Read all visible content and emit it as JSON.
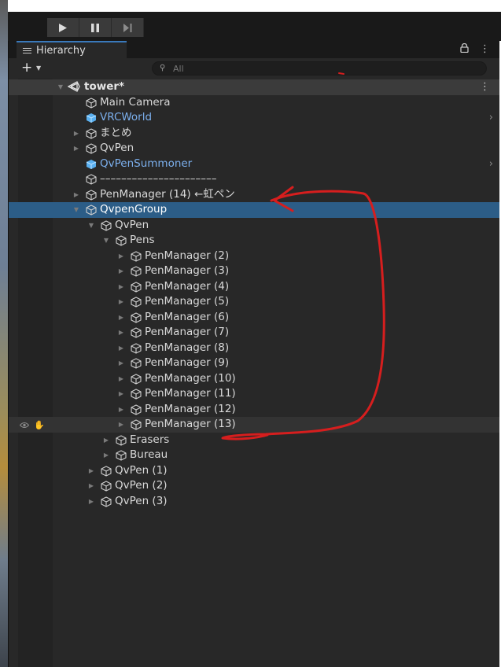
{
  "toolbar": {
    "play_icon": "play-icon",
    "pause_icon": "pause-icon",
    "step_icon": "step-icon"
  },
  "hierarchy_tab": {
    "label": "Hierarchy"
  },
  "search": {
    "add_label": "+",
    "placeholder": "All"
  },
  "scene": {
    "name": "tower*"
  },
  "tree_items": [
    {
      "label": "Main Camera",
      "indent": 1
    },
    {
      "label": "VRCWorld",
      "indent": 1,
      "prefab": true,
      "chevron": true
    },
    {
      "label": "まとめ",
      "indent": 1,
      "arrow": true
    },
    {
      "label": "QvPen",
      "indent": 1,
      "arrow": true
    },
    {
      "label": "QvPenSummoner",
      "indent": 1,
      "prefab": true,
      "chevron": true
    },
    {
      "label": "––––––––––––––––––––––",
      "indent": 1
    },
    {
      "label": "PenManager (14) ←虹ペン",
      "indent": 1,
      "arrow": true
    },
    {
      "label": "QvpenGroup",
      "indent": 1,
      "arrow": true,
      "expanded": true,
      "selected": true
    },
    {
      "label": "QvPen",
      "indent": 2,
      "arrow": true,
      "expanded": true
    },
    {
      "label": "Pens",
      "indent": 3,
      "arrow": true,
      "expanded": true
    },
    {
      "label": "PenManager (2)",
      "indent": 4,
      "arrow": true
    },
    {
      "label": "PenManager (3)",
      "indent": 4,
      "arrow": true
    },
    {
      "label": "PenManager (4)",
      "indent": 4,
      "arrow": true
    },
    {
      "label": "PenManager (5)",
      "indent": 4,
      "arrow": true
    },
    {
      "label": "PenManager (6)",
      "indent": 4,
      "arrow": true
    },
    {
      "label": "PenManager (7)",
      "indent": 4,
      "arrow": true
    },
    {
      "label": "PenManager (8)",
      "indent": 4,
      "arrow": true
    },
    {
      "label": "PenManager (9)",
      "indent": 4,
      "arrow": true
    },
    {
      "label": "PenManager (10)",
      "indent": 4,
      "arrow": true
    },
    {
      "label": "PenManager (11)",
      "indent": 4,
      "arrow": true
    },
    {
      "label": "PenManager (12)",
      "indent": 4,
      "arrow": true
    },
    {
      "label": "PenManager (13)",
      "indent": 4,
      "arrow": true,
      "hovered": true
    },
    {
      "label": "Erasers",
      "indent": 3,
      "arrow": true
    },
    {
      "label": "Bureau",
      "indent": 3,
      "arrow": true
    },
    {
      "label": "QvPen (1)",
      "indent": 2,
      "arrow": true
    },
    {
      "label": "QvPen (2)",
      "indent": 2,
      "arrow": true
    },
    {
      "label": "QvPen (3)",
      "indent": 2,
      "arrow": true
    }
  ],
  "colors": {
    "selection": "#2c5d87",
    "prefab_text": "#7cb0ee",
    "annotation": "#d61e1e"
  }
}
